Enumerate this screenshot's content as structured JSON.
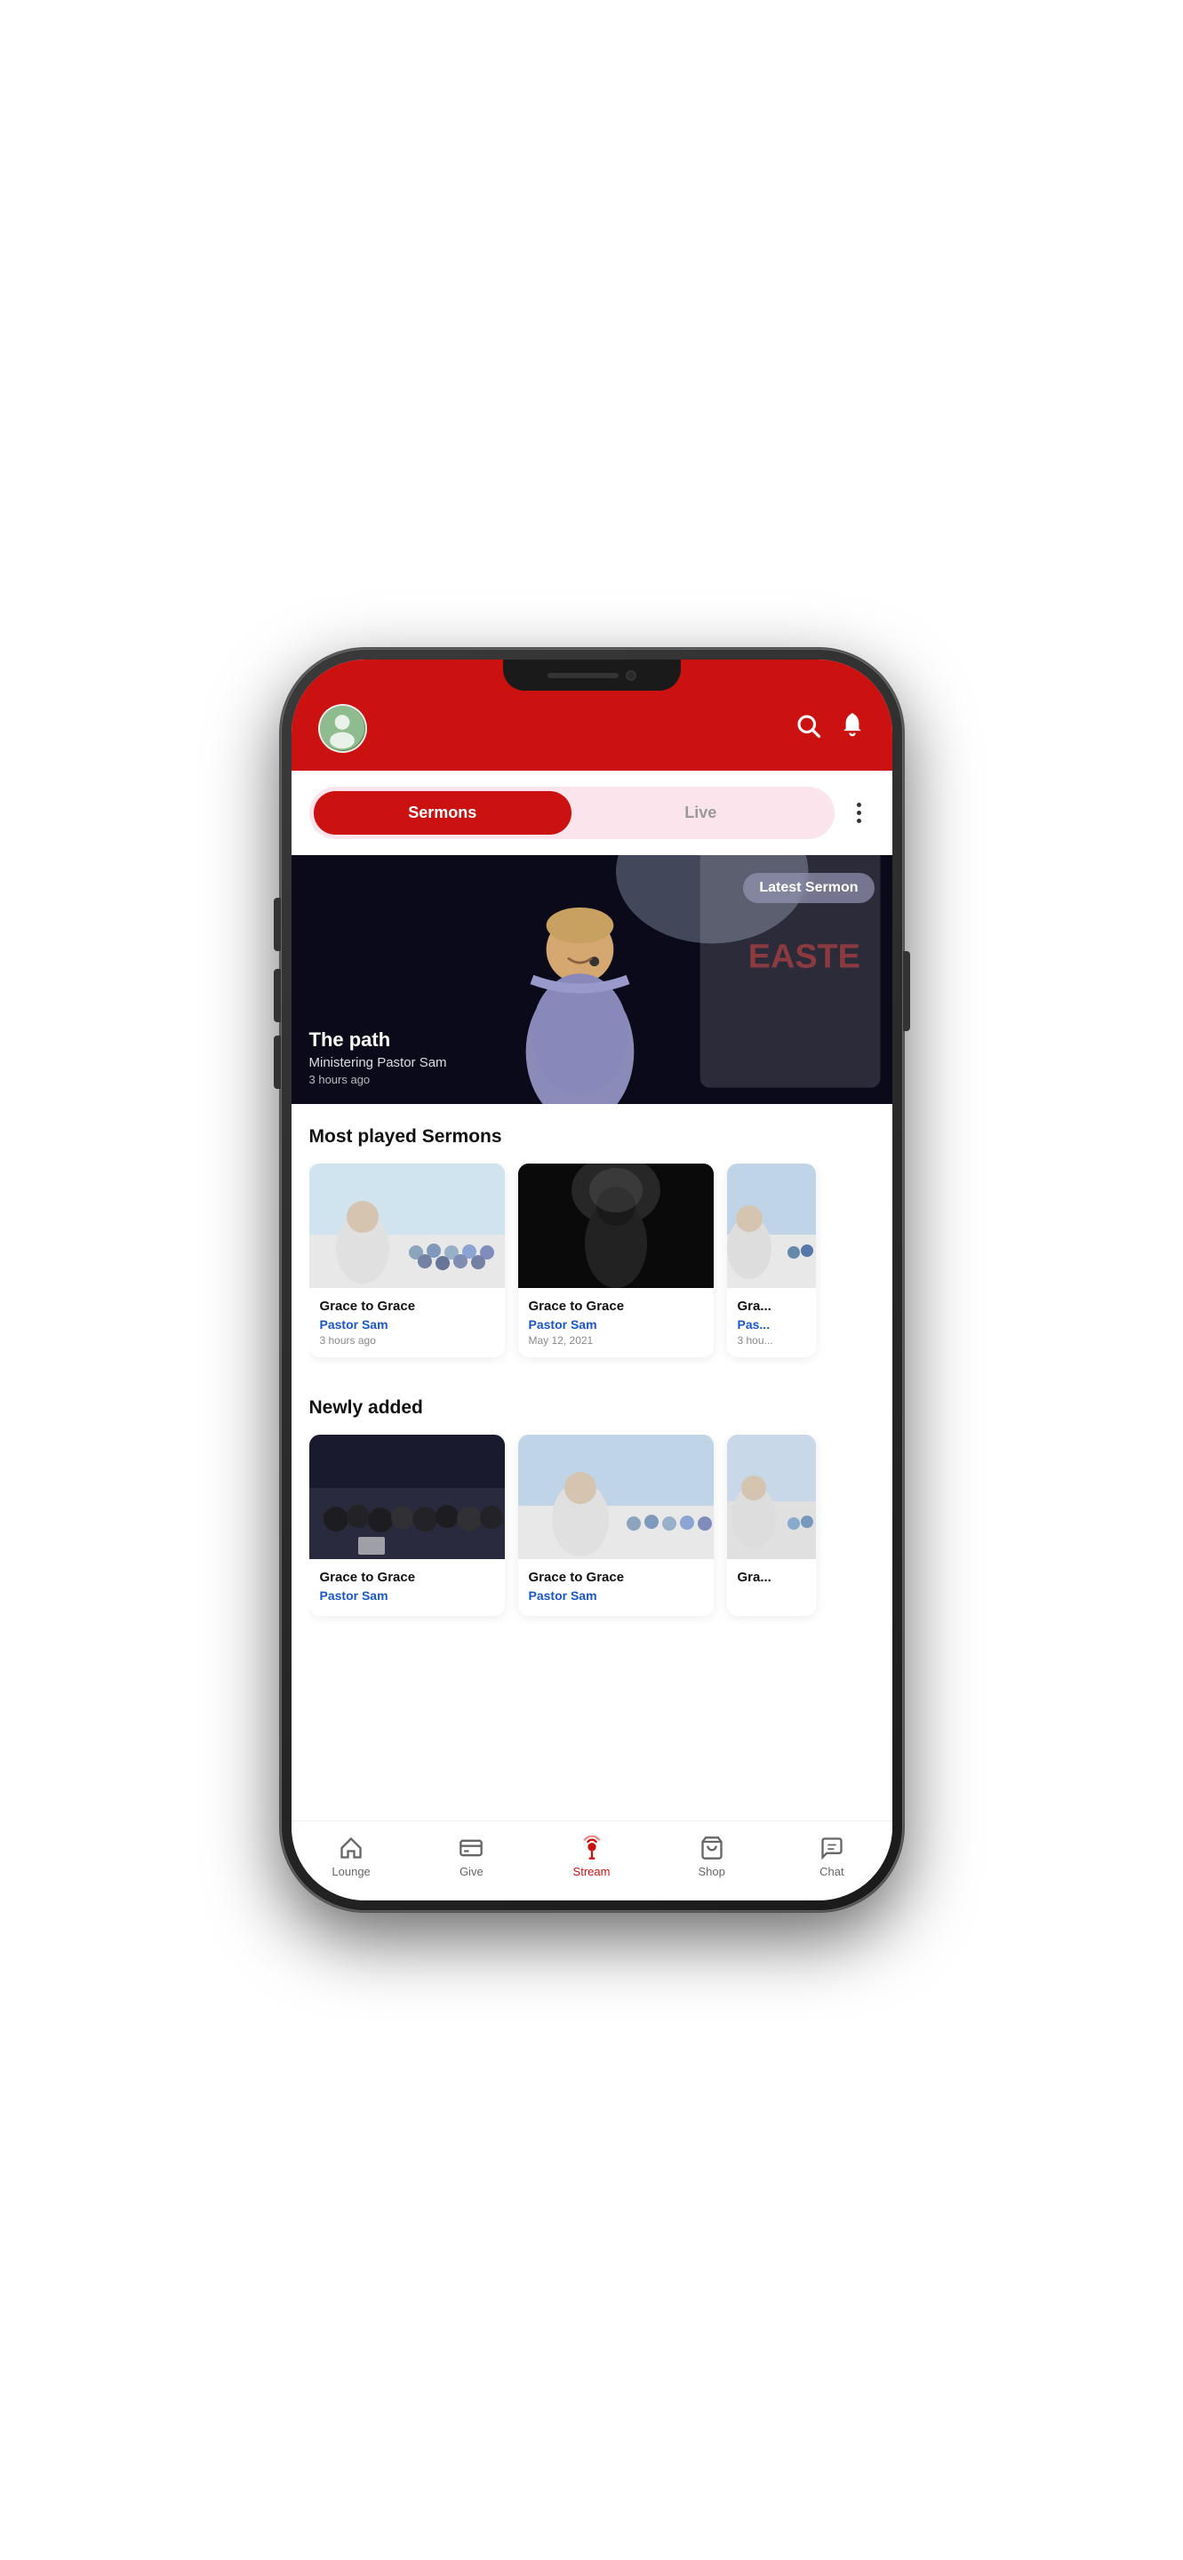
{
  "background": {
    "primary_color": "#8B0000",
    "secondary_color": "#CC1111"
  },
  "header": {
    "avatar_initial": "👤",
    "search_label": "Search",
    "notification_label": "Notifications"
  },
  "tabs": {
    "sermons_label": "Sermons",
    "live_label": "Live",
    "more_label": "More options"
  },
  "hero": {
    "badge": "Latest Sermon",
    "title": "The path",
    "pastor": "Ministering Pastor Sam",
    "time": "3 hours ago"
  },
  "most_played": {
    "section_title": "Most played Sermons",
    "cards": [
      {
        "title": "Grace to Grace",
        "pastor": "Pastor Sam",
        "time": "3 hours ago"
      },
      {
        "title": "Grace to Grace",
        "pastor": "Pastor Sam",
        "time": "May 12, 2021"
      },
      {
        "title": "Gra...",
        "pastor": "Pas...",
        "time": "3 hou..."
      }
    ]
  },
  "newly_added": {
    "section_title": "Newly added",
    "cards": [
      {
        "title": "Grace to Grace",
        "pastor": "Pastor Sam",
        "time": ""
      },
      {
        "title": "Grace to Grace",
        "pastor": "Pastor Sam",
        "time": ""
      },
      {
        "title": "Gra...",
        "pastor": "",
        "time": ""
      }
    ]
  },
  "bottom_nav": {
    "items": [
      {
        "id": "lounge",
        "label": "Lounge",
        "icon": "🏠",
        "active": false
      },
      {
        "id": "give",
        "label": "Give",
        "icon": "💳",
        "active": false
      },
      {
        "id": "stream",
        "label": "Stream",
        "icon": "🎙️",
        "active": true
      },
      {
        "id": "shop",
        "label": "Shop",
        "icon": "🛍️",
        "active": false
      },
      {
        "id": "chat",
        "label": "Chat",
        "icon": "💬",
        "active": false
      }
    ]
  }
}
